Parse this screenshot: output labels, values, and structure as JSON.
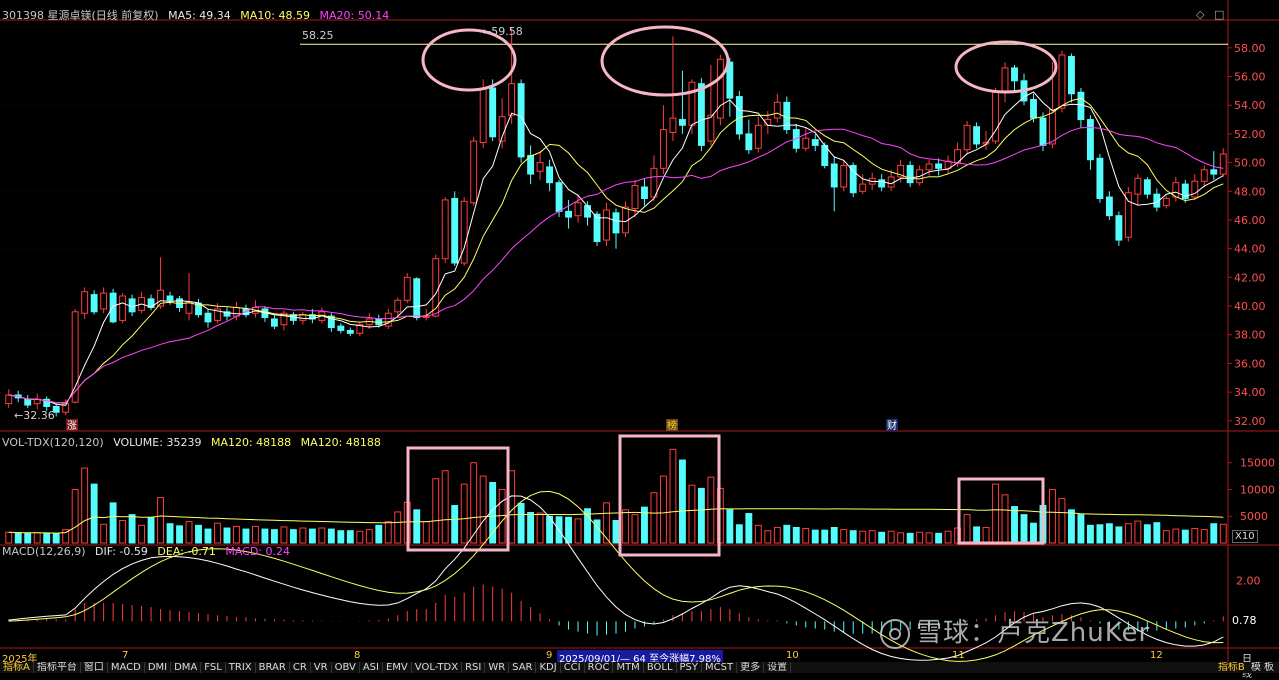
{
  "header": {
    "stock": "301398 星源卓镁(日线 前复权)",
    "ma5": "MA5: 49.34",
    "ma10": "MA10: 48.59",
    "ma20": "MA20: 50.14"
  },
  "vol_header": {
    "name": "VOL-TDX(120,120)",
    "volume": "VOLUME: 35239",
    "ma120a": "MA120: 48188",
    "ma120b": "MA120: 48188"
  },
  "macd_header": {
    "name": "MACD(12,26,9)",
    "dif": "DIF: -0.59",
    "dea": "DEA: -0.71",
    "macd": "MACD: 0.24"
  },
  "annotations": {
    "high_label": "59.58",
    "ref_line_label": "58.25",
    "low_label": "32.36",
    "macd_right": "0.78",
    "marker_zhang": "涨",
    "marker_bang": "榜",
    "marker_cai": "财"
  },
  "x_axis": {
    "year": "2025年",
    "months": [
      "7",
      "8",
      "9",
      "10",
      "11",
      "12"
    ],
    "info": "2025/09/01/— 64 至今涨幅7.98%",
    "period": "日线",
    "x10": "X10"
  },
  "toolbar": {
    "items": [
      "指标A",
      "指标平台",
      "窗口",
      "MACD",
      "DMI",
      "DMA",
      "FSL",
      "TRIX",
      "BRAR",
      "CR",
      "VR",
      "OBV",
      "ASI",
      "EMV",
      "VOL-TDX",
      "RSI",
      "WR",
      "SAR",
      "KDJ",
      "CCI",
      "ROC",
      "MTM",
      "BOLL",
      "PSY",
      "MCST",
      "更多",
      "设置"
    ],
    "right_items": [
      "指标B",
      "模 板"
    ]
  },
  "watermark": "雪球：卢克ZhuKer",
  "colors": {
    "up": "#ff3c3c",
    "down": "#54fcfc",
    "ma5": "#ffffff",
    "ma10": "#ffff66",
    "ma20": "#ff44ff",
    "highlight": "#f7b6c6",
    "axis": "#aa1a1a"
  },
  "chart_data": {
    "type": "candlestick",
    "y_ticks": [
      32,
      34,
      36,
      38,
      40,
      42,
      44,
      46,
      48,
      50,
      52,
      54,
      56,
      58
    ],
    "ylim": [
      31.5,
      59.8
    ],
    "reference_line": 58.25,
    "volume_ticks": [
      5000,
      10000,
      15000
    ],
    "volume_ylim": [
      0,
      17000
    ],
    "macd_ticks": [
      2.0
    ],
    "macd_ylim": [
      -1.4,
      3.0
    ],
    "candles": [
      [
        33.2,
        33.8,
        32.9,
        34.2
      ],
      [
        33.8,
        33.6,
        33.3,
        34.1
      ],
      [
        33.5,
        33.1,
        32.9,
        33.8
      ],
      [
        33.2,
        33.5,
        32.8,
        33.9
      ],
      [
        33.5,
        33.0,
        32.7,
        33.7
      ],
      [
        33.0,
        32.6,
        32.3,
        33.2
      ],
      [
        32.6,
        33.2,
        32.4,
        33.5
      ],
      [
        33.3,
        39.6,
        33.2,
        39.8
      ],
      [
        39.5,
        41.0,
        39.1,
        41.3
      ],
      [
        40.8,
        39.6,
        39.4,
        41.1
      ],
      [
        39.8,
        40.9,
        39.5,
        41.3
      ],
      [
        40.9,
        38.9,
        38.8,
        41.2
      ],
      [
        39.0,
        40.7,
        38.8,
        40.9
      ],
      [
        40.5,
        39.6,
        39.3,
        40.8
      ],
      [
        39.7,
        40.6,
        39.5,
        41.0
      ],
      [
        40.5,
        39.9,
        39.7,
        40.8
      ],
      [
        40.0,
        41.1,
        39.8,
        43.4
      ],
      [
        40.7,
        40.4,
        40.1,
        41.0
      ],
      [
        40.5,
        39.9,
        39.6,
        40.7
      ],
      [
        39.5,
        40.3,
        39.0,
        42.3
      ],
      [
        40.2,
        39.4,
        39.2,
        40.5
      ],
      [
        39.5,
        38.9,
        38.5,
        39.8
      ],
      [
        39.0,
        39.8,
        38.8,
        40.2
      ],
      [
        39.6,
        39.3,
        39.0,
        39.9
      ],
      [
        39.3,
        39.9,
        39.0,
        40.3
      ],
      [
        39.8,
        39.4,
        39.2,
        40.1
      ],
      [
        39.5,
        39.9,
        39.2,
        40.4
      ],
      [
        39.8,
        39.2,
        38.9,
        40.0
      ],
      [
        39.1,
        38.6,
        38.4,
        39.4
      ],
      [
        38.7,
        39.5,
        38.3,
        39.7
      ],
      [
        39.4,
        39.0,
        38.7,
        39.6
      ],
      [
        39.0,
        39.4,
        38.7,
        39.6
      ],
      [
        39.4,
        39.1,
        38.8,
        39.8
      ],
      [
        39.0,
        39.6,
        38.8,
        39.9
      ],
      [
        39.3,
        38.5,
        38.2,
        39.5
      ],
      [
        38.6,
        38.3,
        38.1,
        38.8
      ],
      [
        38.3,
        38.1,
        37.9,
        38.5
      ],
      [
        38.1,
        38.7,
        37.9,
        38.9
      ],
      [
        38.7,
        39.1,
        38.4,
        39.5
      ],
      [
        39.1,
        38.7,
        38.5,
        39.4
      ],
      [
        38.6,
        39.5,
        38.4,
        39.8
      ],
      [
        39.6,
        40.4,
        39.3,
        40.6
      ],
      [
        40.4,
        42.0,
        40.2,
        42.3
      ],
      [
        41.9,
        39.2,
        39.0,
        42.0
      ],
      [
        39.2,
        39.3,
        39.0,
        39.8
      ],
      [
        39.3,
        43.3,
        39.2,
        43.6
      ],
      [
        43.3,
        47.4,
        43.0,
        47.6
      ],
      [
        47.5,
        43.0,
        42.8,
        48.0
      ],
      [
        43.0,
        47.3,
        42.8,
        47.6
      ],
      [
        47.2,
        51.5,
        47.0,
        51.8
      ],
      [
        51.4,
        55.2,
        51.0,
        55.8
      ],
      [
        55.2,
        51.8,
        51.5,
        55.8
      ],
      [
        51.5,
        53.2,
        51.0,
        54.5
      ],
      [
        53.3,
        55.5,
        52.7,
        59.4
      ],
      [
        55.5,
        50.4,
        50.0,
        55.8
      ],
      [
        50.5,
        49.2,
        48.5,
        51.2
      ],
      [
        49.4,
        50.0,
        48.8,
        50.8
      ],
      [
        49.7,
        48.6,
        48.0,
        50.2
      ],
      [
        48.6,
        46.6,
        46.2,
        48.8
      ],
      [
        46.6,
        46.2,
        45.4,
        47.4
      ],
      [
        46.3,
        47.2,
        45.8,
        47.8
      ],
      [
        47.0,
        46.2,
        45.6,
        47.3
      ],
      [
        46.4,
        44.5,
        44.2,
        46.6
      ],
      [
        44.6,
        46.7,
        44.2,
        47.2
      ],
      [
        46.5,
        45.1,
        44.0,
        46.8
      ],
      [
        45.1,
        46.9,
        44.8,
        47.3
      ],
      [
        46.8,
        48.4,
        46.2,
        48.8
      ],
      [
        48.3,
        47.5,
        47.0,
        48.9
      ],
      [
        47.6,
        49.6,
        47.3,
        50.5
      ],
      [
        49.6,
        52.3,
        49.2,
        54.0
      ],
      [
        52.1,
        53.1,
        51.5,
        58.8
      ],
      [
        53.0,
        52.6,
        52.0,
        56.4
      ],
      [
        52.6,
        55.6,
        52.0,
        55.8
      ],
      [
        55.5,
        51.2,
        50.8,
        55.9
      ],
      [
        51.5,
        53.3,
        51.2,
        56.8
      ],
      [
        53.1,
        57.2,
        52.6,
        57.5
      ],
      [
        57.0,
        54.5,
        53.2,
        57.3
      ],
      [
        54.6,
        52.0,
        51.6,
        55.0
      ],
      [
        52.0,
        50.9,
        50.6,
        53.0
      ],
      [
        51.0,
        52.6,
        50.7,
        53.2
      ],
      [
        52.6,
        53.0,
        52.0,
        53.6
      ],
      [
        53.1,
        54.2,
        52.8,
        54.8
      ],
      [
        54.2,
        52.3,
        52.0,
        54.6
      ],
      [
        52.3,
        51.0,
        50.7,
        52.7
      ],
      [
        51.0,
        51.7,
        50.8,
        52.4
      ],
      [
        51.6,
        51.2,
        50.8,
        52.0
      ],
      [
        51.2,
        49.8,
        49.6,
        51.4
      ],
      [
        49.9,
        48.3,
        46.6,
        50.4
      ],
      [
        48.3,
        49.8,
        48.0,
        50.2
      ],
      [
        49.8,
        47.9,
        47.6,
        50.0
      ],
      [
        48.0,
        48.5,
        47.8,
        49.2
      ],
      [
        48.5,
        48.9,
        48.1,
        49.3
      ],
      [
        48.8,
        48.3,
        48.0,
        49.2
      ],
      [
        48.3,
        49.0,
        48.0,
        49.5
      ],
      [
        49.0,
        49.8,
        48.6,
        50.2
      ],
      [
        49.8,
        48.6,
        48.3,
        50.1
      ],
      [
        48.6,
        49.5,
        48.4,
        49.8
      ],
      [
        49.5,
        49.9,
        49.1,
        50.2
      ],
      [
        49.9,
        49.6,
        49.1,
        50.3
      ],
      [
        49.6,
        50.1,
        49.2,
        50.5
      ],
      [
        50.0,
        50.9,
        49.7,
        51.4
      ],
      [
        50.9,
        52.6,
        50.6,
        52.9
      ],
      [
        52.5,
        51.3,
        51.0,
        52.8
      ],
      [
        51.3,
        51.4,
        50.9,
        52.2
      ],
      [
        51.5,
        54.9,
        51.3,
        55.2
      ],
      [
        55.0,
        56.6,
        54.2,
        57.0
      ],
      [
        56.6,
        55.7,
        55.0,
        56.8
      ],
      [
        55.7,
        54.3,
        54.0,
        56.2
      ],
      [
        54.4,
        53.1,
        52.8,
        54.8
      ],
      [
        53.1,
        51.2,
        50.8,
        53.5
      ],
      [
        51.3,
        53.7,
        51.0,
        57.0
      ],
      [
        53.8,
        57.5,
        53.5,
        57.8
      ],
      [
        57.4,
        54.8,
        54.2,
        57.6
      ],
      [
        54.9,
        53.0,
        52.4,
        55.2
      ],
      [
        53.0,
        50.2,
        49.5,
        53.3
      ],
      [
        50.3,
        47.5,
        47.2,
        50.6
      ],
      [
        47.6,
        46.3,
        46.0,
        48.0
      ],
      [
        46.3,
        44.6,
        44.2,
        46.6
      ],
      [
        44.8,
        47.9,
        44.5,
        48.3
      ],
      [
        47.8,
        48.9,
        47.0,
        49.2
      ],
      [
        48.8,
        47.8,
        47.5,
        49.0
      ],
      [
        47.8,
        46.9,
        46.6,
        48.2
      ],
      [
        47.0,
        47.5,
        46.8,
        47.7
      ],
      [
        47.6,
        48.6,
        47.3,
        49.0
      ],
      [
        48.5,
        47.5,
        47.2,
        48.8
      ],
      [
        47.6,
        48.7,
        47.4,
        49.2
      ],
      [
        48.7,
        49.5,
        48.3,
        49.8
      ],
      [
        49.5,
        49.2,
        48.8,
        50.8
      ],
      [
        49.2,
        50.6,
        49.0,
        51.0
      ]
    ],
    "volume": [
      2000,
      1900,
      1800,
      1900,
      1800,
      1700,
      2500,
      10000,
      14000,
      11000,
      3500,
      7500,
      4200,
      5300,
      3300,
      4800,
      8500,
      3600,
      3200,
      4000,
      3300,
      2600,
      3700,
      2800,
      3100,
      2600,
      3100,
      2600,
      2500,
      3000,
      2500,
      2800,
      2600,
      2800,
      2600,
      2300,
      2300,
      2200,
      2500,
      3300,
      4000,
      5800,
      7600,
      6200,
      4000,
      12000,
      13500,
      7000,
      11000,
      15000,
      12500,
      11300,
      10000,
      13500,
      7400,
      5700,
      5600,
      5000,
      4900,
      4800,
      4500,
      6400,
      4300,
      7500,
      4200,
      6200,
      5300,
      6700,
      9400,
      12500,
      17500,
      15500,
      10800,
      10200,
      12300,
      10200,
      6200,
      3400,
      5500,
      3300,
      2300,
      2900,
      3300,
      2900,
      2700,
      2400,
      2400,
      2900,
      2500,
      2300,
      2200,
      2300,
      2000,
      2200,
      1900,
      1800,
      2000,
      1900,
      1800,
      2200,
      2800,
      5300,
      3000,
      2900,
      11000,
      9000,
      6800,
      5300,
      3700,
      7000,
      10000,
      8300,
      6200,
      5300,
      3300,
      3400,
      3600,
      3000,
      3600,
      4100,
      3400,
      3800,
      2300,
      2600,
      2400,
      2700,
      2500,
      3600,
      3500
    ],
    "volume_up": [
      true,
      false,
      false,
      true,
      false,
      false,
      true,
      true,
      true,
      false,
      true,
      false,
      true,
      false,
      true,
      false,
      true,
      false,
      false,
      true,
      false,
      false,
      true,
      false,
      true,
      false,
      true,
      false,
      false,
      true,
      false,
      true,
      false,
      true,
      false,
      false,
      false,
      true,
      true,
      false,
      true,
      true,
      true,
      false,
      true,
      true,
      true,
      false,
      true,
      true,
      true,
      false,
      true,
      true,
      false,
      false,
      true,
      false,
      false,
      false,
      true,
      false,
      false,
      true,
      false,
      true,
      true,
      false,
      true,
      true,
      true,
      false,
      true,
      false,
      true,
      true,
      false,
      false,
      false,
      true,
      true,
      true,
      false,
      false,
      true,
      false,
      false,
      false,
      true,
      false,
      true,
      true,
      false,
      true,
      true,
      false,
      true,
      true,
      false,
      true,
      true,
      true,
      false,
      true,
      true,
      true,
      false,
      false,
      false,
      false,
      true,
      true,
      false,
      false,
      false,
      false,
      false,
      false,
      true,
      true,
      false,
      false,
      true,
      true,
      false,
      true,
      true,
      false,
      true
    ],
    "macd_hist": [
      0.1,
      0.1,
      0.1,
      0.1,
      0.1,
      0.1,
      0.1,
      0.6,
      0.9,
      0.9,
      0.9,
      0.9,
      0.85,
      0.8,
      0.75,
      0.7,
      0.6,
      0.55,
      0.5,
      0.45,
      0.4,
      0.35,
      0.3,
      0.25,
      0.2,
      0.2,
      0.15,
      0.12,
      0.1,
      0.08,
      0.06,
      0.05,
      0.04,
      0.03,
      0.02,
      0.02,
      0.01,
      0.02,
      0.05,
      0.08,
      0.15,
      0.3,
      0.5,
      0.6,
      0.6,
      0.9,
      1.3,
      1.2,
      1.4,
      1.7,
      1.8,
      1.7,
      1.6,
      1.4,
      1.0,
      0.7,
      0.4,
      0.1,
      -0.2,
      -0.4,
      -0.5,
      -0.6,
      -0.7,
      -0.65,
      -0.6,
      -0.5,
      -0.35,
      -0.25,
      -0.1,
      0.1,
      0.3,
      0.4,
      0.5,
      0.5,
      0.6,
      0.7,
      0.6,
      0.4,
      0.2,
      0.1,
      0.05,
      0.05,
      -0.1,
      -0.2,
      -0.3,
      -0.35,
      -0.4,
      -0.5,
      -0.55,
      -0.6,
      -0.6,
      -0.6,
      -0.55,
      -0.5,
      -0.45,
      -0.4,
      -0.35,
      -0.3,
      -0.25,
      -0.2,
      -0.1,
      0.05,
      0.1,
      0.15,
      0.3,
      0.45,
      0.5,
      0.45,
      0.35,
      0.2,
      0.3,
      0.35,
      0.3,
      0.2,
      0.05,
      -0.1,
      -0.3,
      -0.4,
      -0.45,
      -0.5,
      -0.5,
      -0.45,
      -0.4,
      -0.35,
      -0.3,
      -0.2,
      -0.1,
      0.05,
      0.24
    ]
  }
}
